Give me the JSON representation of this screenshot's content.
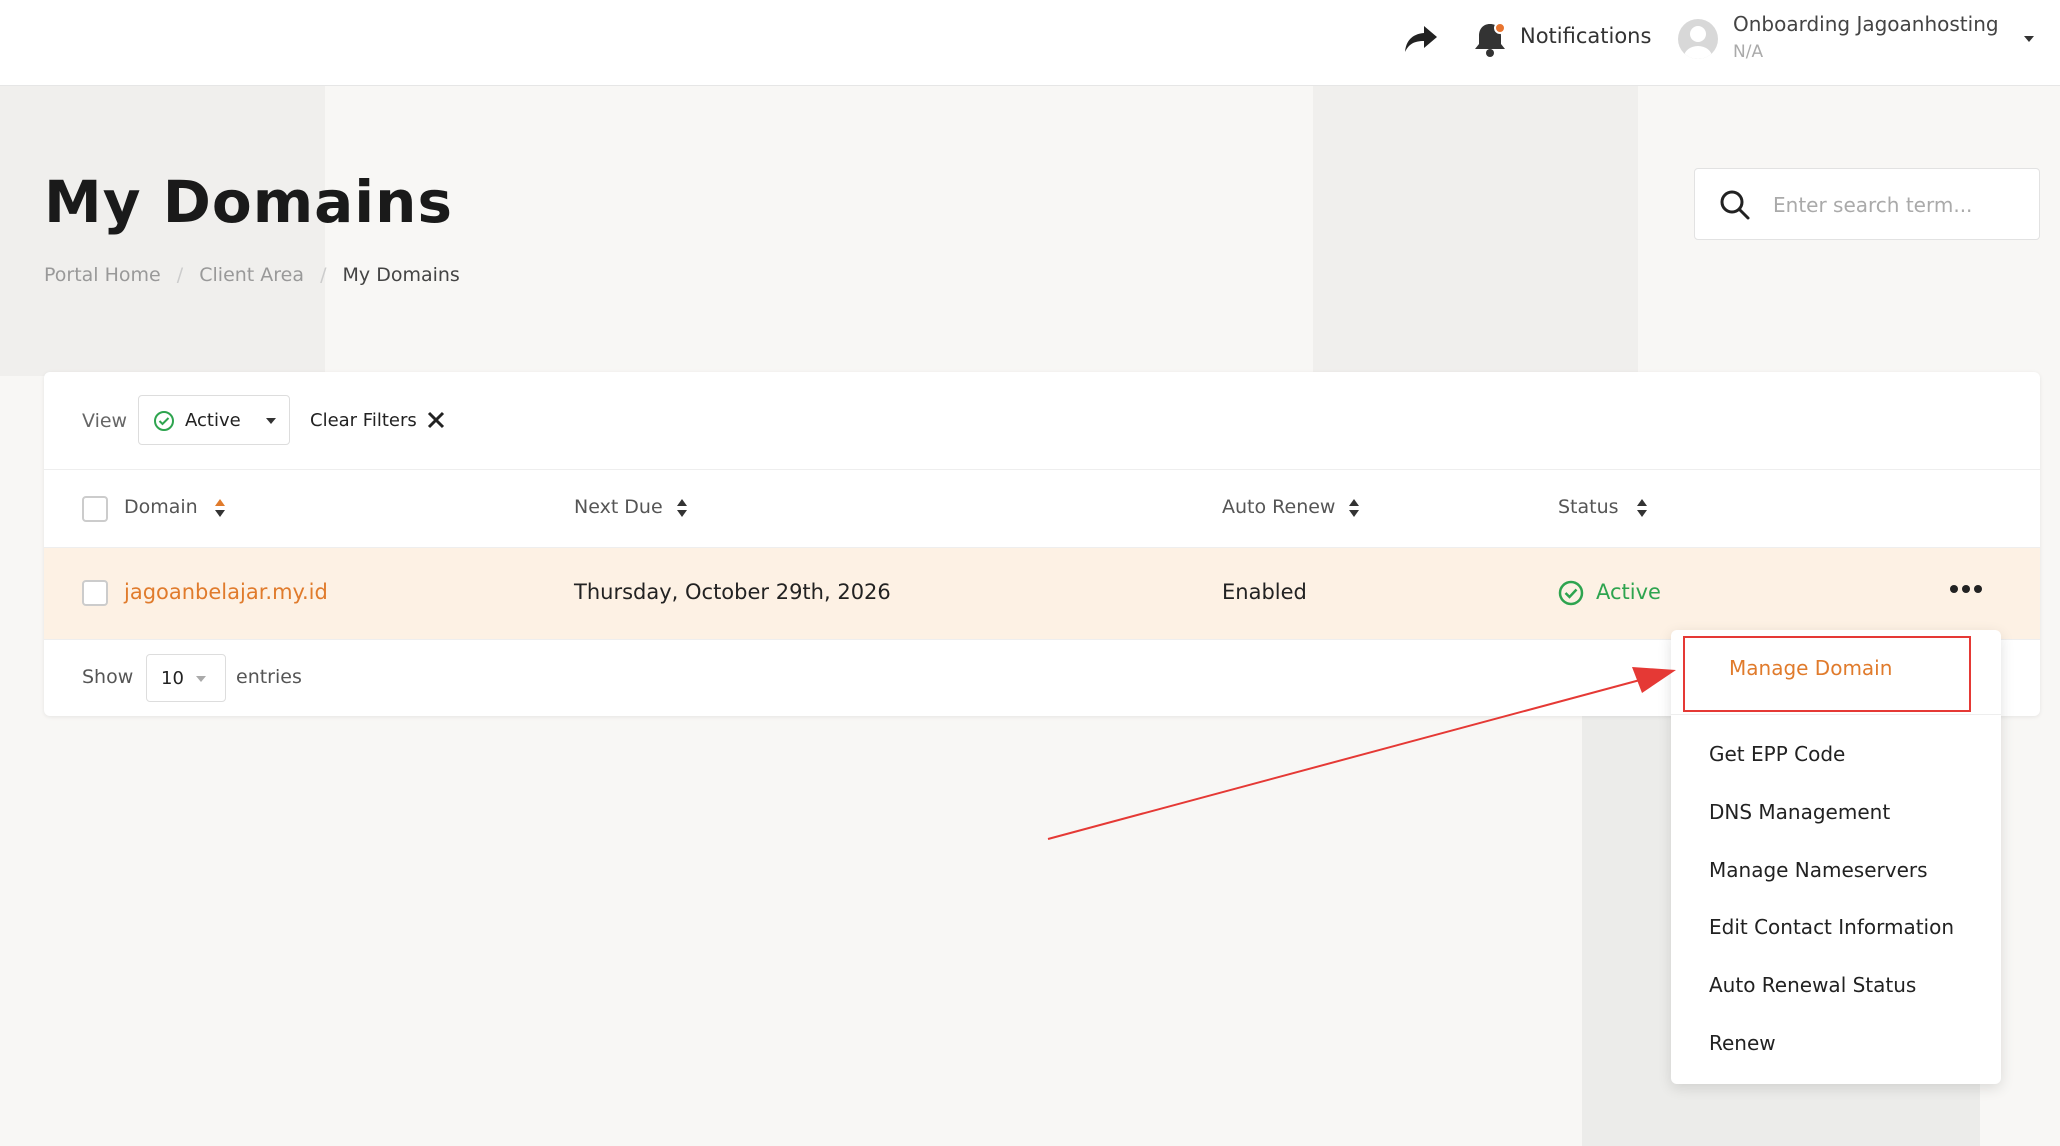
{
  "header": {
    "notifications_label": "Notifications",
    "user_name": "Onboarding Jagoanhosting",
    "user_sub": "N/A"
  },
  "page": {
    "title": "My Domains",
    "breadcrumb": [
      "Portal Home",
      "Client Area",
      "My Domains"
    ]
  },
  "search": {
    "placeholder": "Enter search term..."
  },
  "filters": {
    "view_label": "View",
    "view_value": "Active",
    "clear_label": "Clear Filters"
  },
  "table": {
    "columns": [
      "Domain",
      "Next Due",
      "Auto Renew",
      "Status"
    ],
    "rows": [
      {
        "domain": "jagoanbelajar.my.id",
        "next_due": "Thursday, October 29th, 2026",
        "auto_renew": "Enabled",
        "status": "Active"
      }
    ]
  },
  "pagination": {
    "show_label": "Show",
    "entries_value": "10",
    "entries_label": "entries"
  },
  "dropdown": {
    "items": [
      "Manage Domain",
      "Get EPP Code",
      "DNS Management",
      "Manage Nameservers",
      "Edit Contact Information",
      "Auto Renewal Status",
      "Renew"
    ]
  },
  "colors": {
    "accent": "#e07b2c",
    "active": "#2ea44f",
    "annotation": "#e53935",
    "row_highlight": "#fdf1e4"
  }
}
